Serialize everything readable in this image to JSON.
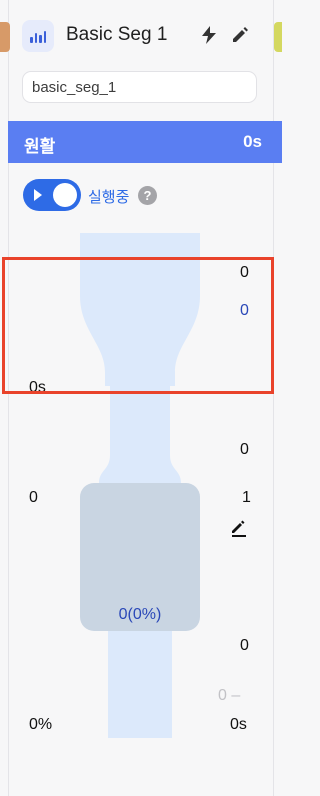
{
  "header": {
    "title": "Basic Seg 1",
    "app_icon": "bar-chart-icon",
    "actions": [
      "lightning-icon",
      "pencil-icon"
    ]
  },
  "segment_id": {
    "value": "basic_seg_1",
    "placeholder": ""
  },
  "status_bar": {
    "label": "원활",
    "time": "0s",
    "color": "#5a7ef2"
  },
  "toggle": {
    "label": "실행중",
    "on": true,
    "help": "?"
  },
  "funnel": {
    "top_count": "0",
    "top_link": "0",
    "left_time": "0s",
    "mid_count": "0",
    "left_count": "0",
    "right_count": "1",
    "box_value": "0(0%)",
    "bottom_count": "0",
    "bottom_minor": "0 –",
    "left_pct": "0%",
    "right_time": "0s"
  },
  "colors": {
    "accent": "#2e6be6",
    "funnel_light": "#dce9fb",
    "funnel_box": "#c9d5e2",
    "highlight": "#e9432b"
  }
}
